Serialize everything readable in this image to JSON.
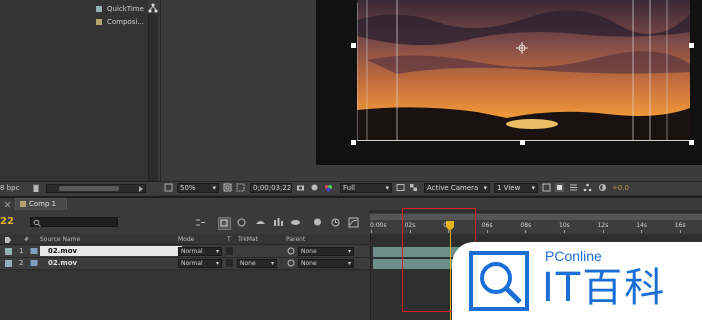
{
  "project_panel": {
    "items": [
      {
        "label": "QuickTime",
        "color": "#8fb3b3"
      },
      {
        "label": "Composi...",
        "color": "#b5a36e"
      }
    ],
    "bpc_label": "8 bpc"
  },
  "viewer_bar": {
    "zoom": "50%",
    "timecode": "0;00;03;22",
    "resolution": "Full",
    "camera": "Active Camera",
    "views": "1 View",
    "exposure": "+0.0"
  },
  "timeline": {
    "tab_label": "Comp 1",
    "current_time": "22",
    "columns": {
      "source_name": "Source Name",
      "mode": "Mode",
      "t": "T",
      "trkmat": "TrkMat",
      "parent": "Parent"
    },
    "layers": [
      {
        "index": "1",
        "name": "02.mov",
        "mode": "Normal",
        "trkmat": "",
        "parent": "None"
      },
      {
        "index": "2",
        "name": "02.mov",
        "mode": "Normal",
        "trkmat": "None",
        "parent": "None"
      }
    ],
    "ruler_labels": [
      "0:00s",
      "02s",
      "04s",
      "06s",
      "08s",
      "10s",
      "12s",
      "14s",
      "16s"
    ],
    "playhead_seconds": 3.8
  },
  "watermark": {
    "brand_en": "PConline",
    "brand_cn": "IT百科",
    "color": "#1a6fd6"
  },
  "colors": {
    "panel_bg": "#3a3a3a",
    "timecode_accent": "#e5b321",
    "layer_bar": "#6d8f8a",
    "highlight_box": "#d42020"
  }
}
